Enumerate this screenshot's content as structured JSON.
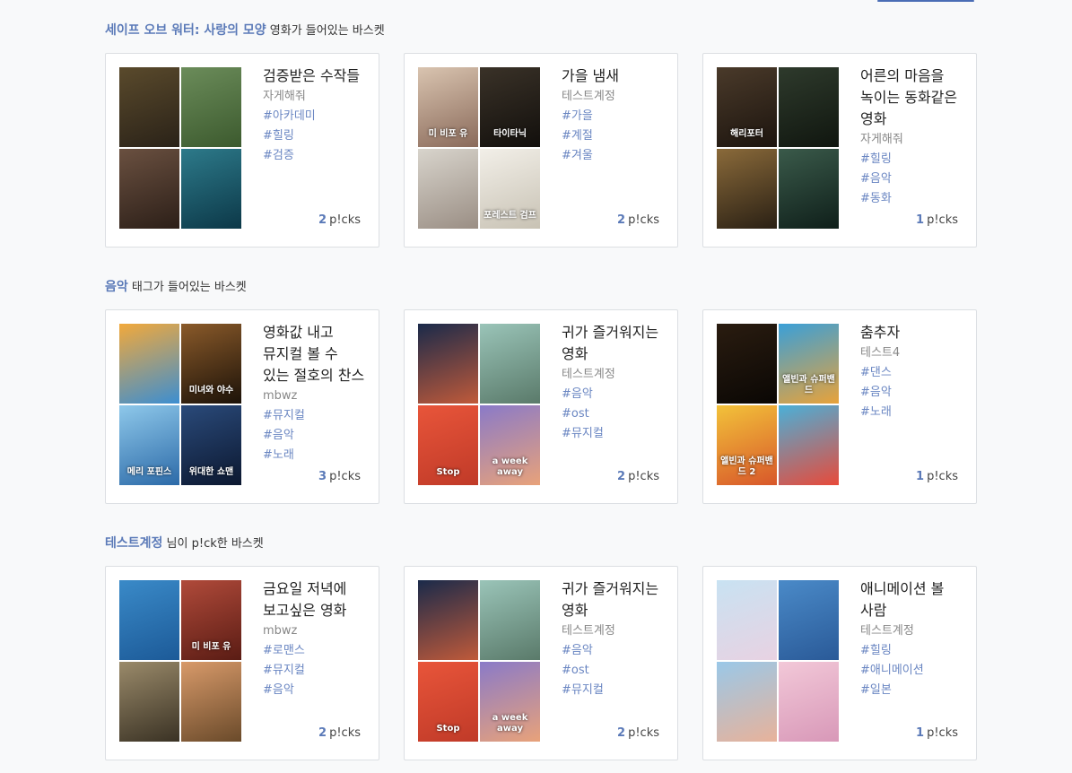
{
  "sections": [
    {
      "highlight": "세이프 오브 워터: 사랑의 모양",
      "suffix": "영화가 들어있는 바스켓",
      "cards": [
        {
          "title": "검증받은 수작들",
          "author": "자게해줘",
          "tags": [
            "#아카데미",
            "#힐링",
            "#검증"
          ],
          "picks_count": "2",
          "picks_label": "p!cks",
          "posters": [
            {
              "caption": "",
              "colors": [
                "#5a4a2c",
                "#2a2218"
              ]
            },
            {
              "caption": "",
              "colors": [
                "#6b8c5a",
                "#3c5a2e"
              ]
            },
            {
              "caption": "",
              "colors": [
                "#6a5040",
                "#2c1f18"
              ]
            },
            {
              "caption": "",
              "colors": [
                "#2d7a8a",
                "#0c3848"
              ]
            }
          ]
        },
        {
          "title": "가을 냄새",
          "author": "테스트계정",
          "tags": [
            "#가을",
            "#계절",
            "#겨울"
          ],
          "picks_count": "2",
          "picks_label": "p!cks",
          "posters": [
            {
              "caption": "미 비포 유",
              "colors": [
                "#d9c4b0",
                "#8a6a5a"
              ]
            },
            {
              "caption": "타이타닉",
              "colors": [
                "#3a3228",
                "#120f0c"
              ]
            },
            {
              "caption": "",
              "colors": [
                "#d8d4cc",
                "#9a8e84"
              ]
            },
            {
              "caption": "포레스트 검프",
              "colors": [
                "#f2efe8",
                "#c8c2b4"
              ]
            }
          ]
        },
        {
          "title": "어른의 마음을 녹이는 동화같은 영화",
          "author": "자게해줘",
          "tags": [
            "#힐링",
            "#음악",
            "#동화"
          ],
          "picks_count": "1",
          "picks_label": "p!cks",
          "posters": [
            {
              "caption": "해리포터",
              "colors": [
                "#4a3a2a",
                "#1c140e"
              ]
            },
            {
              "caption": "",
              "colors": [
                "#2e3a2c",
                "#10160f"
              ]
            },
            {
              "caption": "",
              "colors": [
                "#8a6a3a",
                "#2a2014"
              ]
            },
            {
              "caption": "",
              "colors": [
                "#3a5a4a",
                "#0f1f1a"
              ]
            }
          ]
        }
      ]
    },
    {
      "highlight": "음악",
      "suffix": "태그가 들어있는 바스켓",
      "cards": [
        {
          "title": "영화값 내고 뮤지컬 볼 수 있는 절호의 찬스",
          "author": "mbwz",
          "tags": [
            "#뮤지컬",
            "#음악",
            "#노래"
          ],
          "picks_count": "3",
          "picks_label": "p!cks",
          "posters": [
            {
              "caption": "",
              "colors": [
                "#f2a93b",
                "#3c8ed1"
              ]
            },
            {
              "caption": "미녀와 야수",
              "colors": [
                "#8a5a2a",
                "#1c1208"
              ]
            },
            {
              "caption": "메리 포핀스",
              "colors": [
                "#8ec8ea",
                "#2c6aa8"
              ]
            },
            {
              "caption": "위대한 쇼맨",
              "colors": [
                "#2a4a7a",
                "#0c1830"
              ]
            }
          ]
        },
        {
          "title": "귀가 즐거워지는 영화",
          "author": "테스트계정",
          "tags": [
            "#음악",
            "#ost",
            "#뮤지컬"
          ],
          "picks_count": "2",
          "picks_label": "p!cks",
          "posters": [
            {
              "caption": "",
              "colors": [
                "#1a2a4a",
                "#c05a3a"
              ]
            },
            {
              "caption": "",
              "colors": [
                "#9ac4b8",
                "#5a7a6a"
              ]
            },
            {
              "caption": "Stop",
              "colors": [
                "#e8553a",
                "#c03a28"
              ]
            },
            {
              "caption": "a week away",
              "colors": [
                "#8a7ac8",
                "#e8a27a"
              ]
            }
          ]
        },
        {
          "title": "춤추자",
          "author": "테스트4",
          "tags": [
            "#댄스",
            "#음악",
            "#노래"
          ],
          "picks_count": "1",
          "picks_label": "p!cks",
          "posters": [
            {
              "caption": "",
              "colors": [
                "#2a1c10",
                "#0a0704"
              ]
            },
            {
              "caption": "앨빈과 슈퍼밴드",
              "colors": [
                "#3aa0d8",
                "#e8a23a"
              ]
            },
            {
              "caption": "앨빈과 슈퍼밴드 2",
              "colors": [
                "#f2c23a",
                "#d8572a"
              ]
            },
            {
              "caption": "",
              "colors": [
                "#4ab0d8",
                "#e84a3a"
              ]
            }
          ]
        }
      ]
    },
    {
      "highlight": "테스트계정",
      "suffix": "님이 p!ck한 바스켓",
      "cards": [
        {
          "title": "금요일 저녁에 보고싶은 영화",
          "author": "mbwz",
          "tags": [
            "#로맨스",
            "#뮤지컬",
            "#음악"
          ],
          "picks_count": "2",
          "picks_label": "p!cks",
          "posters": [
            {
              "caption": "",
              "colors": [
                "#3a8ac8",
                "#1c5a98"
              ]
            },
            {
              "caption": "미 비포 유",
              "colors": [
                "#b04a3a",
                "#5a1c14"
              ]
            },
            {
              "caption": "",
              "colors": [
                "#9a8a6a",
                "#3a3224"
              ]
            },
            {
              "caption": "",
              "colors": [
                "#d89a6a",
                "#6a4a2a"
              ]
            }
          ]
        },
        {
          "title": "귀가 즐거워지는 영화",
          "author": "테스트계정",
          "tags": [
            "#음악",
            "#ost",
            "#뮤지컬"
          ],
          "picks_count": "2",
          "picks_label": "p!cks",
          "posters": [
            {
              "caption": "",
              "colors": [
                "#1a2a4a",
                "#c05a3a"
              ]
            },
            {
              "caption": "",
              "colors": [
                "#9ac4b8",
                "#5a7a6a"
              ]
            },
            {
              "caption": "Stop",
              "colors": [
                "#e8553a",
                "#c03a28"
              ]
            },
            {
              "caption": "a week away",
              "colors": [
                "#8a7ac8",
                "#e8a27a"
              ]
            }
          ]
        },
        {
          "title": "애니메이션 볼 사람",
          "author": "테스트계정",
          "tags": [
            "#힐링",
            "#애니메이션",
            "#일본"
          ],
          "picks_count": "1",
          "picks_label": "p!cks",
          "posters": [
            {
              "caption": "",
              "colors": [
                "#c8e2f2",
                "#e8d2e2"
              ]
            },
            {
              "caption": "",
              "colors": [
                "#4a8ac8",
                "#2a5a98"
              ]
            },
            {
              "caption": "",
              "colors": [
                "#9ac8e8",
                "#e8b29a"
              ]
            },
            {
              "caption": "",
              "colors": [
                "#f2c8d8",
                "#d898b8"
              ]
            }
          ]
        }
      ]
    }
  ]
}
